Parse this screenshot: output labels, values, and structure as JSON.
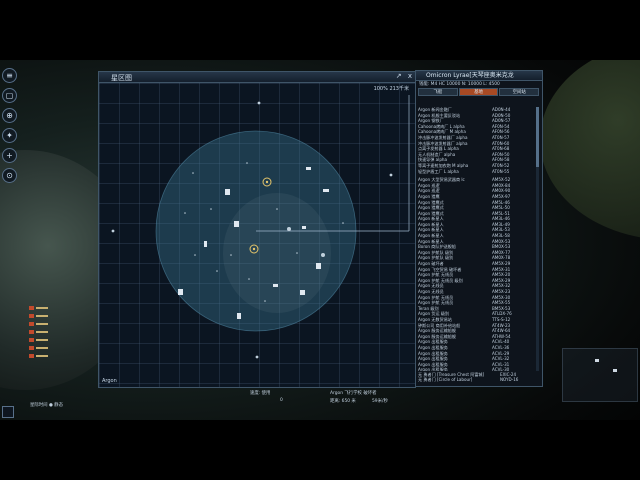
{
  "map_window": {
    "title": "星区图",
    "close_label": "x",
    "zoom_text": "100%  213千米",
    "sector_name": "Argon"
  },
  "right_panel": {
    "title": "Omicron Lyrae[天琴座奥米克龙",
    "subtitle": "钱能: M4  HC 10000  N: 10000  L: 4500",
    "tabs": [
      "飞船",
      "基地",
      "空间站"
    ],
    "list": [
      {
        "name": "Argon 新闻金融厂",
        "code": "AD0N-44"
      },
      {
        "name": "Argon 机舰主要反驳站",
        "code": "AD0N-50"
      },
      {
        "name": "Argon 钢铁厂",
        "code": "AD0N-57"
      },
      {
        "name": "Cahoona烤肉厂 L alpha",
        "code": "AF0N-54"
      },
      {
        "name": "Cahoona烤肉厂 M alpha",
        "code": "AF0N-56"
      },
      {
        "name": "冲击脉冲波发射器厂 alpha",
        "code": "AT0N-57"
      },
      {
        "name": "冲击脉冲波发射器厂 alpha",
        "code": "AT0N-60"
      },
      {
        "name": "点离子发射器 L alpha",
        "code": "AT0N-68"
      },
      {
        "name": "无人机制造厂 alpha",
        "code": "AF0N-50"
      },
      {
        "name": "快速导弹 alpha",
        "code": "AF0N-58"
      },
      {
        "name": "等离子速射加农炮 M alpha",
        "code": "AT0N-52"
      },
      {
        "name": "轻型护盾工厂 L alpha",
        "code": "AT0N-55"
      },
      {
        "name": "",
        "code": ""
      },
      {
        "name": "Argon 大型贸易武器商 lc",
        "code": "AM5X-52"
      },
      {
        "name": "Argon 巡逻",
        "code": "AM0X-84"
      },
      {
        "name": "Argon 巡逻",
        "code": "AM0X-90"
      },
      {
        "name": "Argon 猎鹰",
        "code": "AM5X-97"
      },
      {
        "name": "Argon 猎鹰式",
        "code": "AM5L-46"
      },
      {
        "name": "Argon 猎鹰式",
        "code": "AM5L-50"
      },
      {
        "name": "Argon 猎鹰式",
        "code": "AM5L-51"
      },
      {
        "name": "Argon 新星人",
        "code": "AM3L-46"
      },
      {
        "name": "Argon 新星人",
        "code": "AM3L-49"
      },
      {
        "name": "Argon 新星人",
        "code": "AM3L-53"
      },
      {
        "name": "Argon 新星人",
        "code": "AM3L-58"
      },
      {
        "name": "Argon 新星人",
        "code": "AM0X-53"
      },
      {
        "name": "Boron 商队护送舰船",
        "code": "BM0X-53"
      },
      {
        "name": "Argon 护航队 级别",
        "code": "AM0X-77"
      },
      {
        "name": "Argon 护航队 级别",
        "code": "AM0X-78"
      },
      {
        "name": "Argon 破坏者",
        "code": "AM5X-29"
      },
      {
        "name": "Argon 飞空贸易 破坏者",
        "code": "AM5X-31"
      },
      {
        "name": "Argon 护航 无线员",
        "code": "AM5X-20"
      },
      {
        "name": "Argon 护航 无线员 级别",
        "code": "AM5X-29"
      },
      {
        "name": "Argon 无线员",
        "code": "AM5X-32"
      },
      {
        "name": "Argon 无线员",
        "code": "AM5X-23"
      },
      {
        "name": "Argon 护航 无线员",
        "code": "AM5X-30"
      },
      {
        "name": "Argon 护航 无线员",
        "code": "AM5X-55"
      },
      {
        "name": "Teran 级别",
        "code": "BM5X-53"
      },
      {
        "name": "Argon 货运 级别",
        "code": "ATLDX-76"
      },
      {
        "name": "Argon 无数贸易站",
        "code": "TTS-S-12"
      },
      {
        "name": "钟斯公司 商用补给站船",
        "code": "AT4W-23"
      },
      {
        "name": "Argon 服务运输船舰",
        "code": "AT4W-64"
      },
      {
        "name": "Argon 服务运输船舰",
        "code": "ATHW-54"
      },
      {
        "name": "Argon 出租服务",
        "code": "ACVL-40"
      },
      {
        "name": "Argon 出租服务",
        "code": "ACVL-36"
      },
      {
        "name": "Argon 出租服务",
        "code": "ACVL-29"
      },
      {
        "name": "Argon 出租服务",
        "code": "ACVL-32"
      },
      {
        "name": "Argon 出租服务",
        "code": "ACVL-31"
      },
      {
        "name": "Argon 出租服务",
        "code": "ACVL-30"
      },
      {
        "name": "Argon 新兵运输船",
        "code": "ACVL-43"
      },
      {
        "name": "Argon 货物运输船",
        "code": "ACVL-42"
      },
      {
        "name": "Argon 货物运输船",
        "code": "ACVL-34"
      }
    ],
    "footer": [
      {
        "name": "无 勇者门 [Treasure Chest 阿富城]",
        "code": "EXIC-24"
      },
      {
        "name": "无 勇者门 [Circle of Labour]",
        "code": "NOYD-16"
      }
    ]
  },
  "left_toolbar": [
    "≡",
    "▢",
    "⊕",
    "✦",
    "+",
    "⊙"
  ],
  "left_icon_rows": 7,
  "bottom_left": {
    "label": "星际时间  ● 静态"
  },
  "bottom_center": {
    "speed_label": "速度: 使用",
    "speed_value": "  0   ",
    "target_label": "Argon 飞行学校 破坏者",
    "target_detail": "距离: 650 米",
    "target_value": "59米/秒"
  },
  "colors": {
    "accent_tab": "#a84a24",
    "grid": "#5a7896",
    "panel_border": "#3f5568"
  }
}
